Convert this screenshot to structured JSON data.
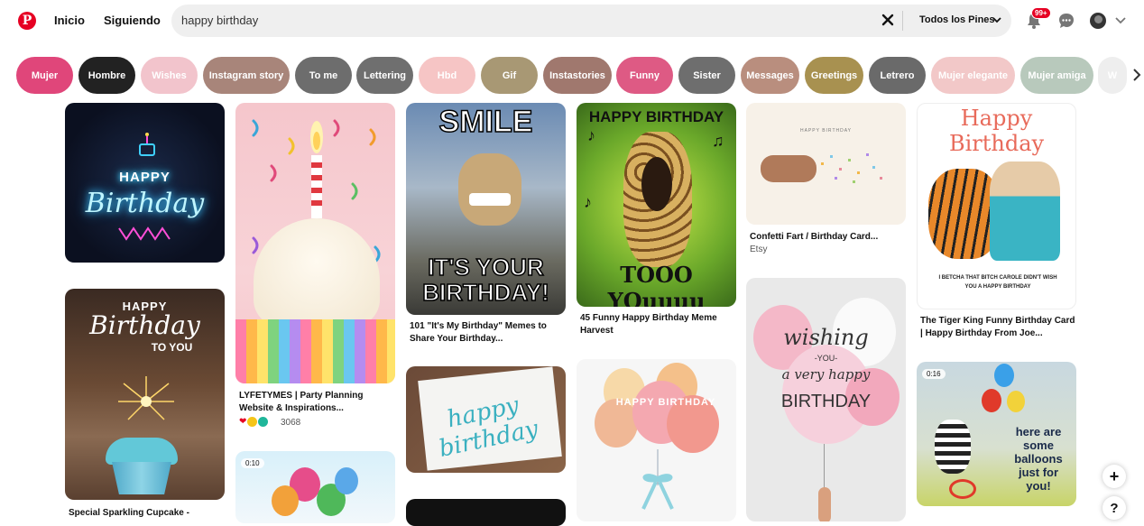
{
  "header": {
    "nav": [
      "Inicio",
      "Siguiendo"
    ],
    "search": {
      "value": "happy birthday",
      "filter": "Todos los Pines"
    },
    "notifications_badge": "99+"
  },
  "chips": [
    {
      "label": "Mujer",
      "color": "#e0467a"
    },
    {
      "label": "Hombre",
      "color": "#222222"
    },
    {
      "label": "Wishes",
      "color": "#f2c4cc"
    },
    {
      "label": "Instagram story",
      "color": "#a8857a"
    },
    {
      "label": "To me",
      "color": "#6d6d6d"
    },
    {
      "label": "Lettering",
      "color": "#6f6f6f"
    },
    {
      "label": "Hbd",
      "color": "#f6c5c5"
    },
    {
      "label": "Gif",
      "color": "#a89874"
    },
    {
      "label": "Instastories",
      "color": "#a0786e"
    },
    {
      "label": "Funny",
      "color": "#de5a84"
    },
    {
      "label": "Sister",
      "color": "#6e6e6e"
    },
    {
      "label": "Messages",
      "color": "#b98e7e"
    },
    {
      "label": "Greetings",
      "color": "#a89150"
    },
    {
      "label": "Letrero",
      "color": "#6a6a6a"
    },
    {
      "label": "Mujer elegante",
      "color": "#f2c8c8"
    },
    {
      "label": "Mujer amiga",
      "color": "#b8c9bc"
    },
    {
      "label": "W",
      "color": "#eeeeee"
    }
  ],
  "pins": {
    "neon": {
      "line1": "HAPPY",
      "line2": "Birthday"
    },
    "sparkle": {
      "line1": "HAPPY",
      "line2": "Birthday",
      "line3": "TO YOU",
      "caption": "Special Sparkling Cupcake -"
    },
    "cupcake": {
      "caption": "LYFETYMES | Party Planning Website & Inspirations...",
      "reactions": "3068"
    },
    "balloons_video": {
      "timer": "0:10"
    },
    "dog": {
      "top": "SMILE",
      "bottom": "IT'S YOUR BIRTHDAY!",
      "caption": "101 \"It's My Birthday\" Memes to Share Your Birthday..."
    },
    "lettering": {
      "text": "happy birthday"
    },
    "giraffe": {
      "top": "HAPPY BIRTHDAY",
      "bottom": "TOOO YOuuuu",
      "caption": "45 Funny Happy Birthday Meme Harvest"
    },
    "balloon_bunch": {
      "text": "HAPPY BIRTHDAY"
    },
    "confetti": {
      "card_text": "HAPPY BIRTHDAY",
      "caption": "Confetti Fart / Birthday Card...",
      "source": "Etsy"
    },
    "wishing": {
      "line1": "wishing",
      "line2": "-YOU-",
      "line3": "a very happy",
      "line4": "BIRTHDAY"
    },
    "tiger": {
      "title1": "Happy",
      "title2": "Birthday",
      "text": "I BETCHA THAT BITCH CAROLE DIDN'T WISH YOU A HAPPY BIRTHDAY",
      "caption": "The Tiger King Funny Birthday Card | Happy Birthday From Joe..."
    },
    "bear": {
      "timer": "0:16",
      "text": "here are some balloons just for you!"
    }
  }
}
